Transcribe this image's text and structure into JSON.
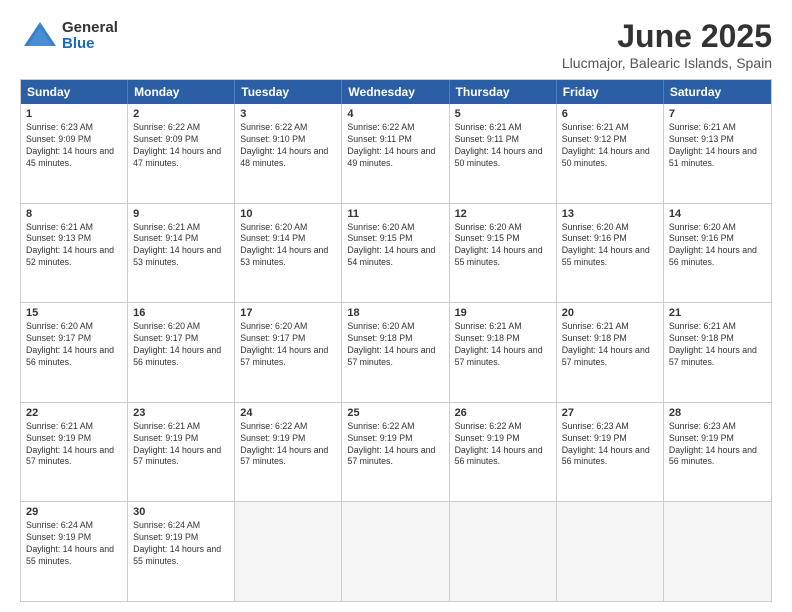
{
  "logo": {
    "general": "General",
    "blue": "Blue"
  },
  "title": "June 2025",
  "location": "Llucmajor, Balearic Islands, Spain",
  "days": [
    "Sunday",
    "Monday",
    "Tuesday",
    "Wednesday",
    "Thursday",
    "Friday",
    "Saturday"
  ],
  "weeks": [
    [
      {
        "day": "1",
        "sunrise": "6:23 AM",
        "sunset": "9:09 PM",
        "daylight": "14 hours and 45 minutes."
      },
      {
        "day": "2",
        "sunrise": "6:22 AM",
        "sunset": "9:09 PM",
        "daylight": "14 hours and 47 minutes."
      },
      {
        "day": "3",
        "sunrise": "6:22 AM",
        "sunset": "9:10 PM",
        "daylight": "14 hours and 48 minutes."
      },
      {
        "day": "4",
        "sunrise": "6:22 AM",
        "sunset": "9:11 PM",
        "daylight": "14 hours and 49 minutes."
      },
      {
        "day": "5",
        "sunrise": "6:21 AM",
        "sunset": "9:11 PM",
        "daylight": "14 hours and 50 minutes."
      },
      {
        "day": "6",
        "sunrise": "6:21 AM",
        "sunset": "9:12 PM",
        "daylight": "14 hours and 50 minutes."
      },
      {
        "day": "7",
        "sunrise": "6:21 AM",
        "sunset": "9:13 PM",
        "daylight": "14 hours and 51 minutes."
      }
    ],
    [
      {
        "day": "8",
        "sunrise": "6:21 AM",
        "sunset": "9:13 PM",
        "daylight": "14 hours and 52 minutes."
      },
      {
        "day": "9",
        "sunrise": "6:21 AM",
        "sunset": "9:14 PM",
        "daylight": "14 hours and 53 minutes."
      },
      {
        "day": "10",
        "sunrise": "6:20 AM",
        "sunset": "9:14 PM",
        "daylight": "14 hours and 53 minutes."
      },
      {
        "day": "11",
        "sunrise": "6:20 AM",
        "sunset": "9:15 PM",
        "daylight": "14 hours and 54 minutes."
      },
      {
        "day": "12",
        "sunrise": "6:20 AM",
        "sunset": "9:15 PM",
        "daylight": "14 hours and 55 minutes."
      },
      {
        "day": "13",
        "sunrise": "6:20 AM",
        "sunset": "9:16 PM",
        "daylight": "14 hours and 55 minutes."
      },
      {
        "day": "14",
        "sunrise": "6:20 AM",
        "sunset": "9:16 PM",
        "daylight": "14 hours and 56 minutes."
      }
    ],
    [
      {
        "day": "15",
        "sunrise": "6:20 AM",
        "sunset": "9:17 PM",
        "daylight": "14 hours and 56 minutes."
      },
      {
        "day": "16",
        "sunrise": "6:20 AM",
        "sunset": "9:17 PM",
        "daylight": "14 hours and 56 minutes."
      },
      {
        "day": "17",
        "sunrise": "6:20 AM",
        "sunset": "9:17 PM",
        "daylight": "14 hours and 57 minutes."
      },
      {
        "day": "18",
        "sunrise": "6:20 AM",
        "sunset": "9:18 PM",
        "daylight": "14 hours and 57 minutes."
      },
      {
        "day": "19",
        "sunrise": "6:21 AM",
        "sunset": "9:18 PM",
        "daylight": "14 hours and 57 minutes."
      },
      {
        "day": "20",
        "sunrise": "6:21 AM",
        "sunset": "9:18 PM",
        "daylight": "14 hours and 57 minutes."
      },
      {
        "day": "21",
        "sunrise": "6:21 AM",
        "sunset": "9:18 PM",
        "daylight": "14 hours and 57 minutes."
      }
    ],
    [
      {
        "day": "22",
        "sunrise": "6:21 AM",
        "sunset": "9:19 PM",
        "daylight": "14 hours and 57 minutes."
      },
      {
        "day": "23",
        "sunrise": "6:21 AM",
        "sunset": "9:19 PM",
        "daylight": "14 hours and 57 minutes."
      },
      {
        "day": "24",
        "sunrise": "6:22 AM",
        "sunset": "9:19 PM",
        "daylight": "14 hours and 57 minutes."
      },
      {
        "day": "25",
        "sunrise": "6:22 AM",
        "sunset": "9:19 PM",
        "daylight": "14 hours and 57 minutes."
      },
      {
        "day": "26",
        "sunrise": "6:22 AM",
        "sunset": "9:19 PM",
        "daylight": "14 hours and 56 minutes."
      },
      {
        "day": "27",
        "sunrise": "6:23 AM",
        "sunset": "9:19 PM",
        "daylight": "14 hours and 56 minutes."
      },
      {
        "day": "28",
        "sunrise": "6:23 AM",
        "sunset": "9:19 PM",
        "daylight": "14 hours and 56 minutes."
      }
    ],
    [
      {
        "day": "29",
        "sunrise": "6:24 AM",
        "sunset": "9:19 PM",
        "daylight": "14 hours and 55 minutes."
      },
      {
        "day": "30",
        "sunrise": "6:24 AM",
        "sunset": "9:19 PM",
        "daylight": "14 hours and 55 minutes."
      },
      null,
      null,
      null,
      null,
      null
    ]
  ]
}
